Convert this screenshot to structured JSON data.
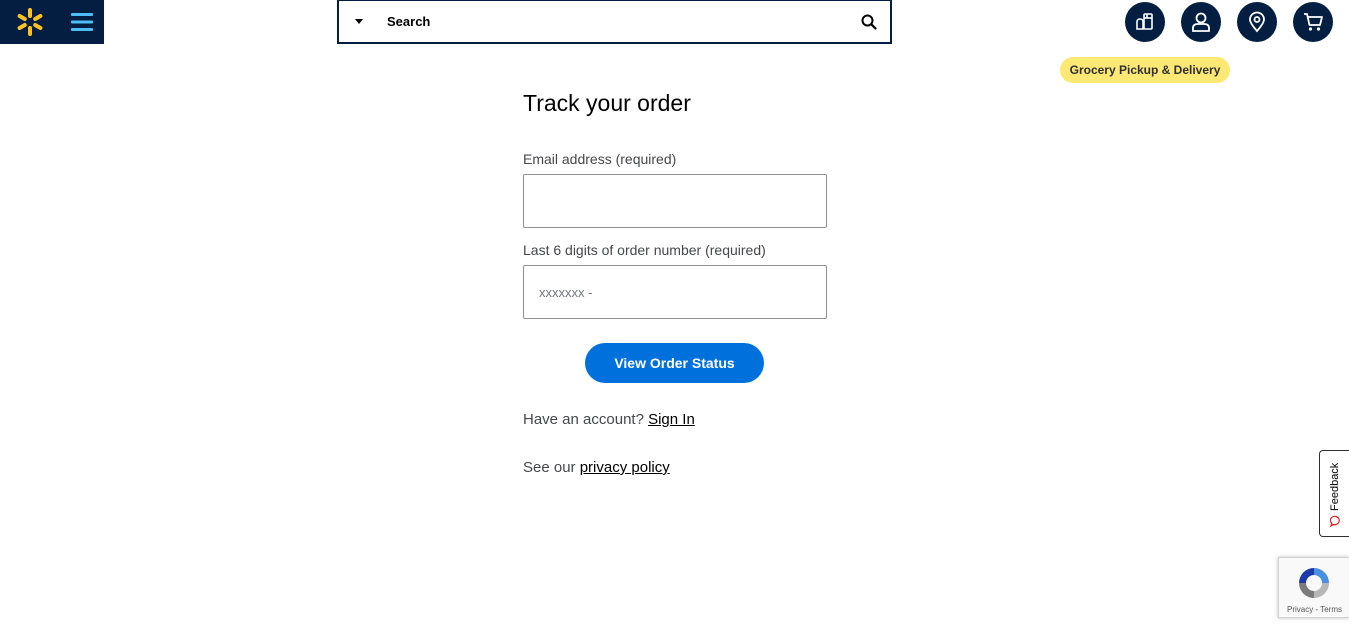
{
  "header": {
    "logo_alt": "Walmart",
    "search": {
      "placeholder": "Search"
    },
    "nav_icons": [
      "grocery-icon",
      "account-icon",
      "store-location-icon",
      "cart-icon"
    ],
    "tooltip": "Grocery Pickup & Delivery"
  },
  "form": {
    "title": "Track your order",
    "email_label": "Email address (required)",
    "email_value": "",
    "order_label": "Last 6 digits of order number (required)",
    "order_placeholder": "xxxxxxx -",
    "submit_label": "View Order Status"
  },
  "account": {
    "prompt": "Have an account?",
    "sign_in": "Sign In"
  },
  "privacy": {
    "prompt": "See our",
    "link": "privacy policy"
  },
  "feedback": {
    "label": "Feedback"
  },
  "recaptcha": {
    "text": "Privacy - Terms"
  },
  "colors": {
    "brand_navy": "#041e42",
    "spark_yellow": "#ffc220",
    "menu_blue": "#4dbdf5",
    "primary_blue": "#0071dc",
    "tooltip_yellow": "#ffe873"
  }
}
